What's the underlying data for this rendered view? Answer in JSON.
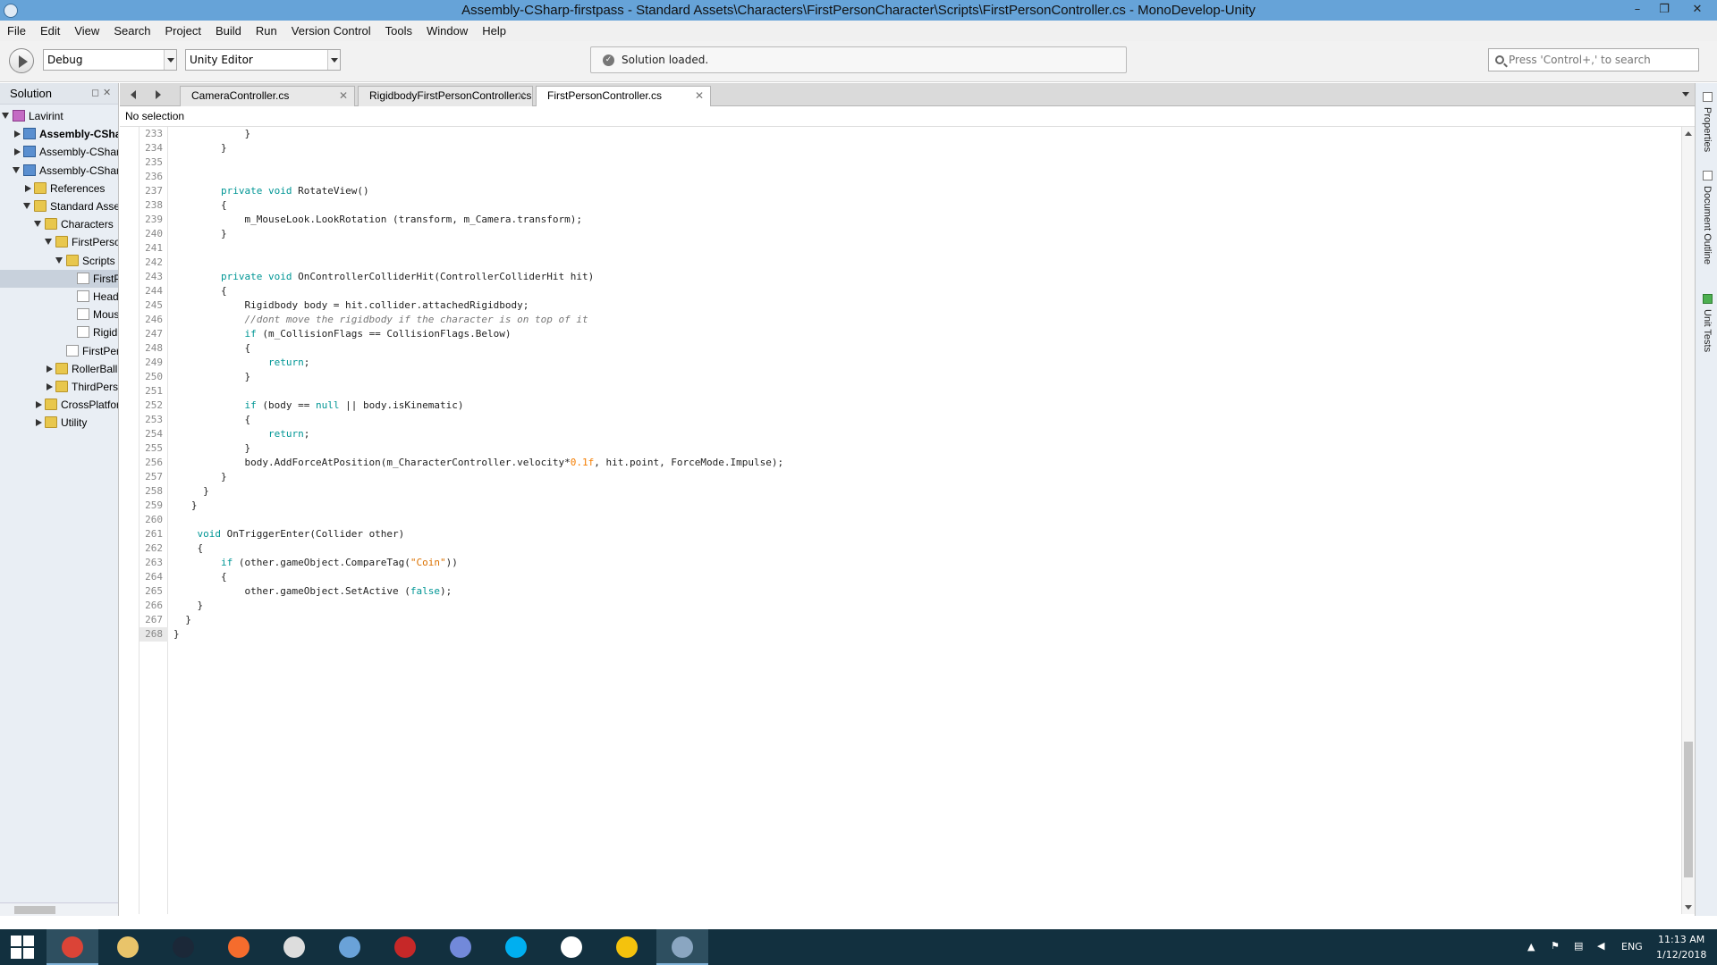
{
  "window": {
    "title": "Assembly-CSharp-firstpass - Standard Assets\\Characters\\FirstPersonCharacter\\Scripts\\FirstPersonController.cs - MonoDevelop-Unity",
    "minimize": "–",
    "maximize": "❐",
    "close": "✕"
  },
  "menu": [
    "File",
    "Edit",
    "View",
    "Search",
    "Project",
    "Build",
    "Run",
    "Version Control",
    "Tools",
    "Window",
    "Help"
  ],
  "toolbar": {
    "configuration": "Debug",
    "target": "Unity Editor",
    "status_text": "Solution loaded.",
    "search_placeholder": "Press 'Control+,' to search"
  },
  "solution": {
    "title": "Solution",
    "pin": "◻",
    "close": "✕",
    "tree": [
      {
        "label": "Lavirint",
        "indent": 0,
        "expander": "open",
        "icon": "sol",
        "bold": false
      },
      {
        "label": "Assembly-CSharp",
        "indent": 1,
        "expander": "closed",
        "icon": "proj",
        "bold": true
      },
      {
        "label": "Assembly-CSharp-Editor",
        "indent": 1,
        "expander": "closed",
        "icon": "proj",
        "bold": false
      },
      {
        "label": "Assembly-CSharp-firstpass",
        "indent": 1,
        "expander": "open",
        "icon": "proj",
        "bold": false
      },
      {
        "label": "References",
        "indent": 2,
        "expander": "closed",
        "icon": "folder",
        "bold": false
      },
      {
        "label": "Standard Assets",
        "indent": 2,
        "expander": "open",
        "icon": "folder",
        "bold": false
      },
      {
        "label": "Characters",
        "indent": 3,
        "expander": "open",
        "icon": "folder",
        "bold": false
      },
      {
        "label": "FirstPersonCharacter",
        "indent": 4,
        "expander": "open",
        "icon": "folder",
        "bold": false
      },
      {
        "label": "Scripts",
        "indent": 5,
        "expander": "open",
        "icon": "folder",
        "bold": false
      },
      {
        "label": "FirstPersonController.cs",
        "indent": 6,
        "expander": "",
        "icon": "file",
        "bold": false,
        "selected": true
      },
      {
        "label": "HeadBob.cs",
        "indent": 6,
        "expander": "",
        "icon": "file",
        "bold": false
      },
      {
        "label": "MouseLook.cs",
        "indent": 6,
        "expander": "",
        "icon": "file",
        "bold": false
      },
      {
        "label": "RigidbodyFirstPersonController.cs",
        "indent": 6,
        "expander": "",
        "icon": "file",
        "bold": false
      },
      {
        "label": "FirstPersonCharacterGuidelines.txt",
        "indent": 5,
        "expander": "",
        "icon": "file",
        "bold": false
      },
      {
        "label": "RollerBall",
        "indent": 4,
        "expander": "closed",
        "icon": "folder",
        "bold": false
      },
      {
        "label": "ThirdPersonCharacter",
        "indent": 4,
        "expander": "closed",
        "icon": "folder",
        "bold": false
      },
      {
        "label": "CrossPlatformInput",
        "indent": 3,
        "expander": "closed",
        "icon": "folder",
        "bold": false
      },
      {
        "label": "Utility",
        "indent": 3,
        "expander": "closed",
        "icon": "folder",
        "bold": false
      }
    ]
  },
  "tabs": [
    {
      "label": "CameraController.cs",
      "active": false
    },
    {
      "label": "RigidbodyFirstPersonController.cs",
      "active": false
    },
    {
      "label": "FirstPersonController.cs",
      "active": true
    }
  ],
  "tab_close": "✕",
  "path_bar": "No selection",
  "editor": {
    "current_line": "268",
    "lines": [
      {
        "n": "233",
        "t": [
          [
            "",
            "            }"
          ]
        ]
      },
      {
        "n": "234",
        "t": [
          [
            "",
            "        }"
          ]
        ]
      },
      {
        "n": "235",
        "t": []
      },
      {
        "n": "236",
        "t": []
      },
      {
        "n": "237",
        "t": [
          [
            "",
            "        "
          ],
          [
            "kw",
            "private void"
          ],
          [
            "",
            " RotateView()"
          ]
        ]
      },
      {
        "n": "238",
        "t": [
          [
            "",
            "        {"
          ]
        ]
      },
      {
        "n": "239",
        "t": [
          [
            "",
            "            m_MouseLook.LookRotation (transform, m_Camera.transform);"
          ]
        ]
      },
      {
        "n": "240",
        "t": [
          [
            "",
            "        }"
          ]
        ]
      },
      {
        "n": "241",
        "t": []
      },
      {
        "n": "242",
        "t": []
      },
      {
        "n": "243",
        "t": [
          [
            "",
            "        "
          ],
          [
            "kw",
            "private void"
          ],
          [
            "",
            " OnControllerColliderHit(ControllerColliderHit hit)"
          ]
        ]
      },
      {
        "n": "244",
        "t": [
          [
            "",
            "        {"
          ]
        ]
      },
      {
        "n": "245",
        "t": [
          [
            "",
            "            Rigidbody body = hit.collider.attachedRigidbody;"
          ]
        ]
      },
      {
        "n": "246",
        "t": [
          [
            "",
            "            "
          ],
          [
            "cm",
            "//dont move the rigidbody if the character is on top of it"
          ]
        ]
      },
      {
        "n": "247",
        "t": [
          [
            "",
            "            "
          ],
          [
            "kw",
            "if"
          ],
          [
            "",
            " (m_CollisionFlags == CollisionFlags.Below)"
          ]
        ]
      },
      {
        "n": "248",
        "t": [
          [
            "",
            "            {"
          ]
        ]
      },
      {
        "n": "249",
        "t": [
          [
            "",
            "                "
          ],
          [
            "kw",
            "return"
          ],
          [
            "",
            ";"
          ]
        ]
      },
      {
        "n": "250",
        "t": [
          [
            "",
            "            }"
          ]
        ]
      },
      {
        "n": "251",
        "t": []
      },
      {
        "n": "252",
        "t": [
          [
            "",
            "            "
          ],
          [
            "kw",
            "if"
          ],
          [
            "",
            " (body == "
          ],
          [
            "kw",
            "null"
          ],
          [
            "",
            " || body.isKinematic)"
          ]
        ]
      },
      {
        "n": "253",
        "t": [
          [
            "",
            "            {"
          ]
        ]
      },
      {
        "n": "254",
        "t": [
          [
            "",
            "                "
          ],
          [
            "kw",
            "return"
          ],
          [
            "",
            ";"
          ]
        ]
      },
      {
        "n": "255",
        "t": [
          [
            "",
            "            }"
          ]
        ]
      },
      {
        "n": "256",
        "t": [
          [
            "",
            "            body.AddForceAtPosition(m_CharacterController.velocity*"
          ],
          [
            "num",
            "0.1f"
          ],
          [
            "",
            ", hit.point, ForceMode.Impulse);"
          ]
        ]
      },
      {
        "n": "257",
        "t": [
          [
            "",
            "        }"
          ]
        ]
      },
      {
        "n": "258",
        "t": [
          [
            "",
            "     }"
          ]
        ]
      },
      {
        "n": "259",
        "t": [
          [
            "",
            "   }"
          ]
        ]
      },
      {
        "n": "260",
        "t": []
      },
      {
        "n": "261",
        "t": [
          [
            "",
            "    "
          ],
          [
            "kw",
            "void"
          ],
          [
            "",
            " OnTriggerEnter(Collider other)"
          ]
        ]
      },
      {
        "n": "262",
        "t": [
          [
            "",
            "    {"
          ]
        ]
      },
      {
        "n": "263",
        "t": [
          [
            "",
            "        "
          ],
          [
            "kw",
            "if"
          ],
          [
            "",
            " (other.gameObject.CompareTag("
          ],
          [
            "str",
            "\"Coin\""
          ],
          [
            "",
            "))"
          ]
        ]
      },
      {
        "n": "264",
        "t": [
          [
            "",
            "        {"
          ]
        ]
      },
      {
        "n": "265",
        "t": [
          [
            "",
            "            other.gameObject.SetActive ("
          ],
          [
            "kw",
            "false"
          ],
          [
            "",
            ");"
          ]
        ]
      },
      {
        "n": "266",
        "t": [
          [
            "",
            "    }"
          ]
        ]
      },
      {
        "n": "267",
        "t": [
          [
            "",
            "  }"
          ]
        ]
      },
      {
        "n": "268",
        "t": [
          [
            "",
            "}"
          ]
        ]
      }
    ]
  },
  "right_pads": [
    "Properties",
    "Document Outline",
    "Unit Tests"
  ],
  "taskbar": {
    "apps": [
      "Google Chrome",
      "File Explorer",
      "Steam",
      "Origin",
      "App",
      "Fallout Shelter",
      "Uplay",
      "Discord",
      "Skype",
      "Unity",
      "Game",
      "MonoDevelop-Unity"
    ],
    "language": "ENG",
    "time": "11:13 AM",
    "date": "1/12/2018"
  }
}
